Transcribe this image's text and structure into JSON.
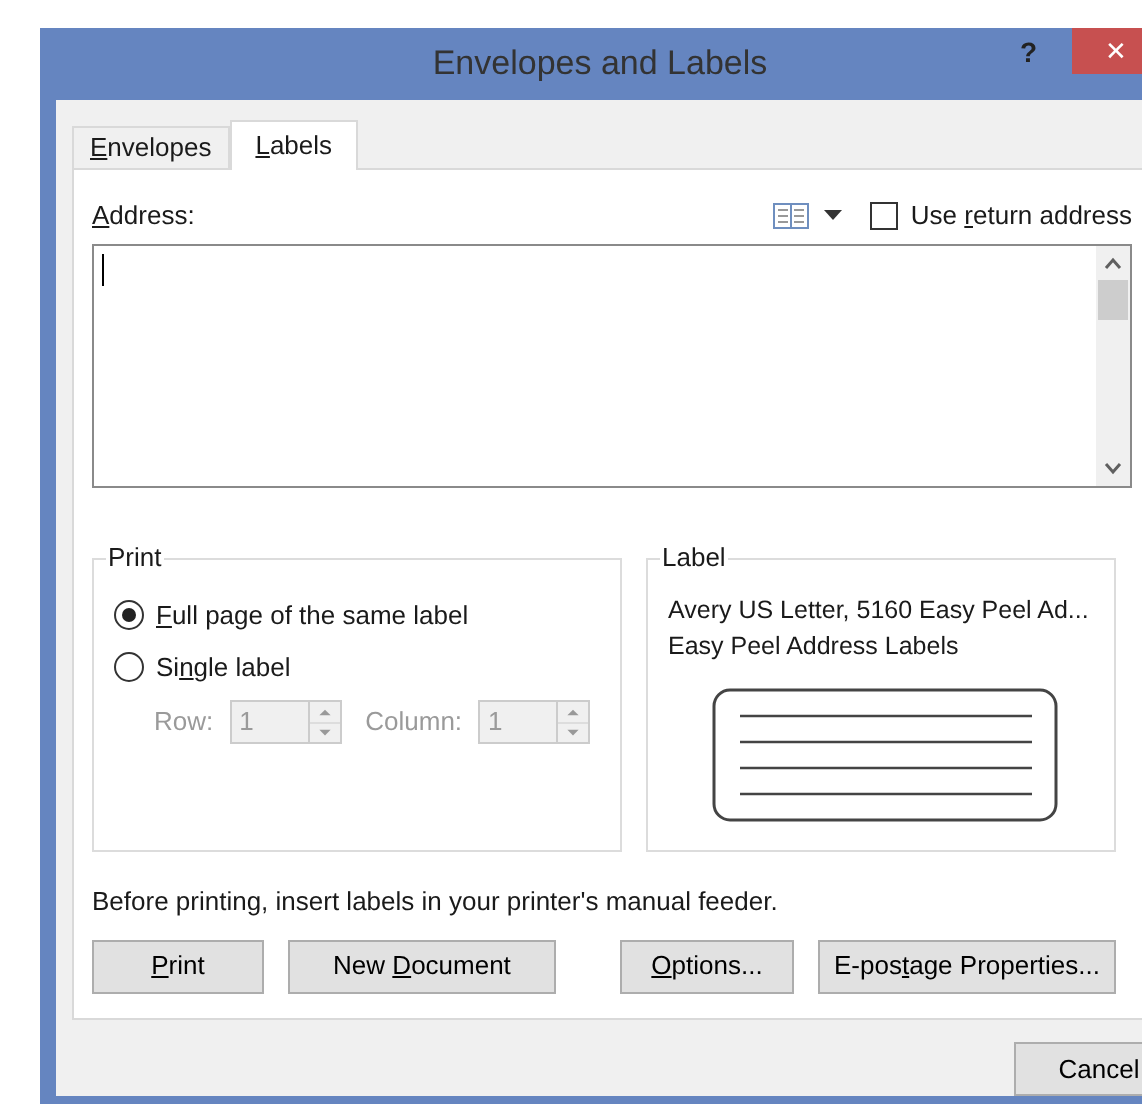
{
  "window": {
    "title": "Envelopes and Labels",
    "help": "?",
    "close": "✕"
  },
  "tabs": [
    {
      "label": {
        "access_key": "E",
        "after": "nvelopes"
      },
      "selected": false
    },
    {
      "label": {
        "access_key": "L",
        "after": "abels"
      },
      "selected": true
    }
  ],
  "address": {
    "label": {
      "access_key": "A",
      "after": "ddress:"
    },
    "use_return_address": {
      "label": {
        "before": "Use ",
        "access_key": "r",
        "after": "eturn address"
      },
      "checked": false
    }
  },
  "print_group": {
    "title": "Print",
    "options": [
      {
        "label": {
          "access_key": "F",
          "after": "ull page of the same label"
        },
        "selected": true
      },
      {
        "label": {
          "before": "Si",
          "access_key": "n",
          "after": "gle label"
        },
        "selected": false
      }
    ],
    "row": {
      "label": "Row:",
      "value": "1",
      "disabled": true
    },
    "column": {
      "label": "Column:",
      "value": "1",
      "disabled": true
    }
  },
  "label_group": {
    "title": "Label",
    "lines": [
      "Avery US Letter, 5160 Easy Peel Ad...",
      "Easy Peel Address Labels"
    ]
  },
  "note": "Before printing, insert labels in your printer's manual feeder.",
  "buttons": [
    {
      "label": {
        "access_key": "P",
        "after": "rint"
      }
    },
    {
      "label": {
        "before": "New ",
        "access_key": "D",
        "after": "ocument"
      }
    },
    {
      "label": {
        "access_key": "O",
        "after": "ptions..."
      }
    },
    {
      "label": {
        "before": "E-pos",
        "access_key": "t",
        "after": "age Properties..."
      }
    }
  ],
  "footer_buttons": [
    {
      "label": {
        "before": "Cancel"
      }
    }
  ]
}
